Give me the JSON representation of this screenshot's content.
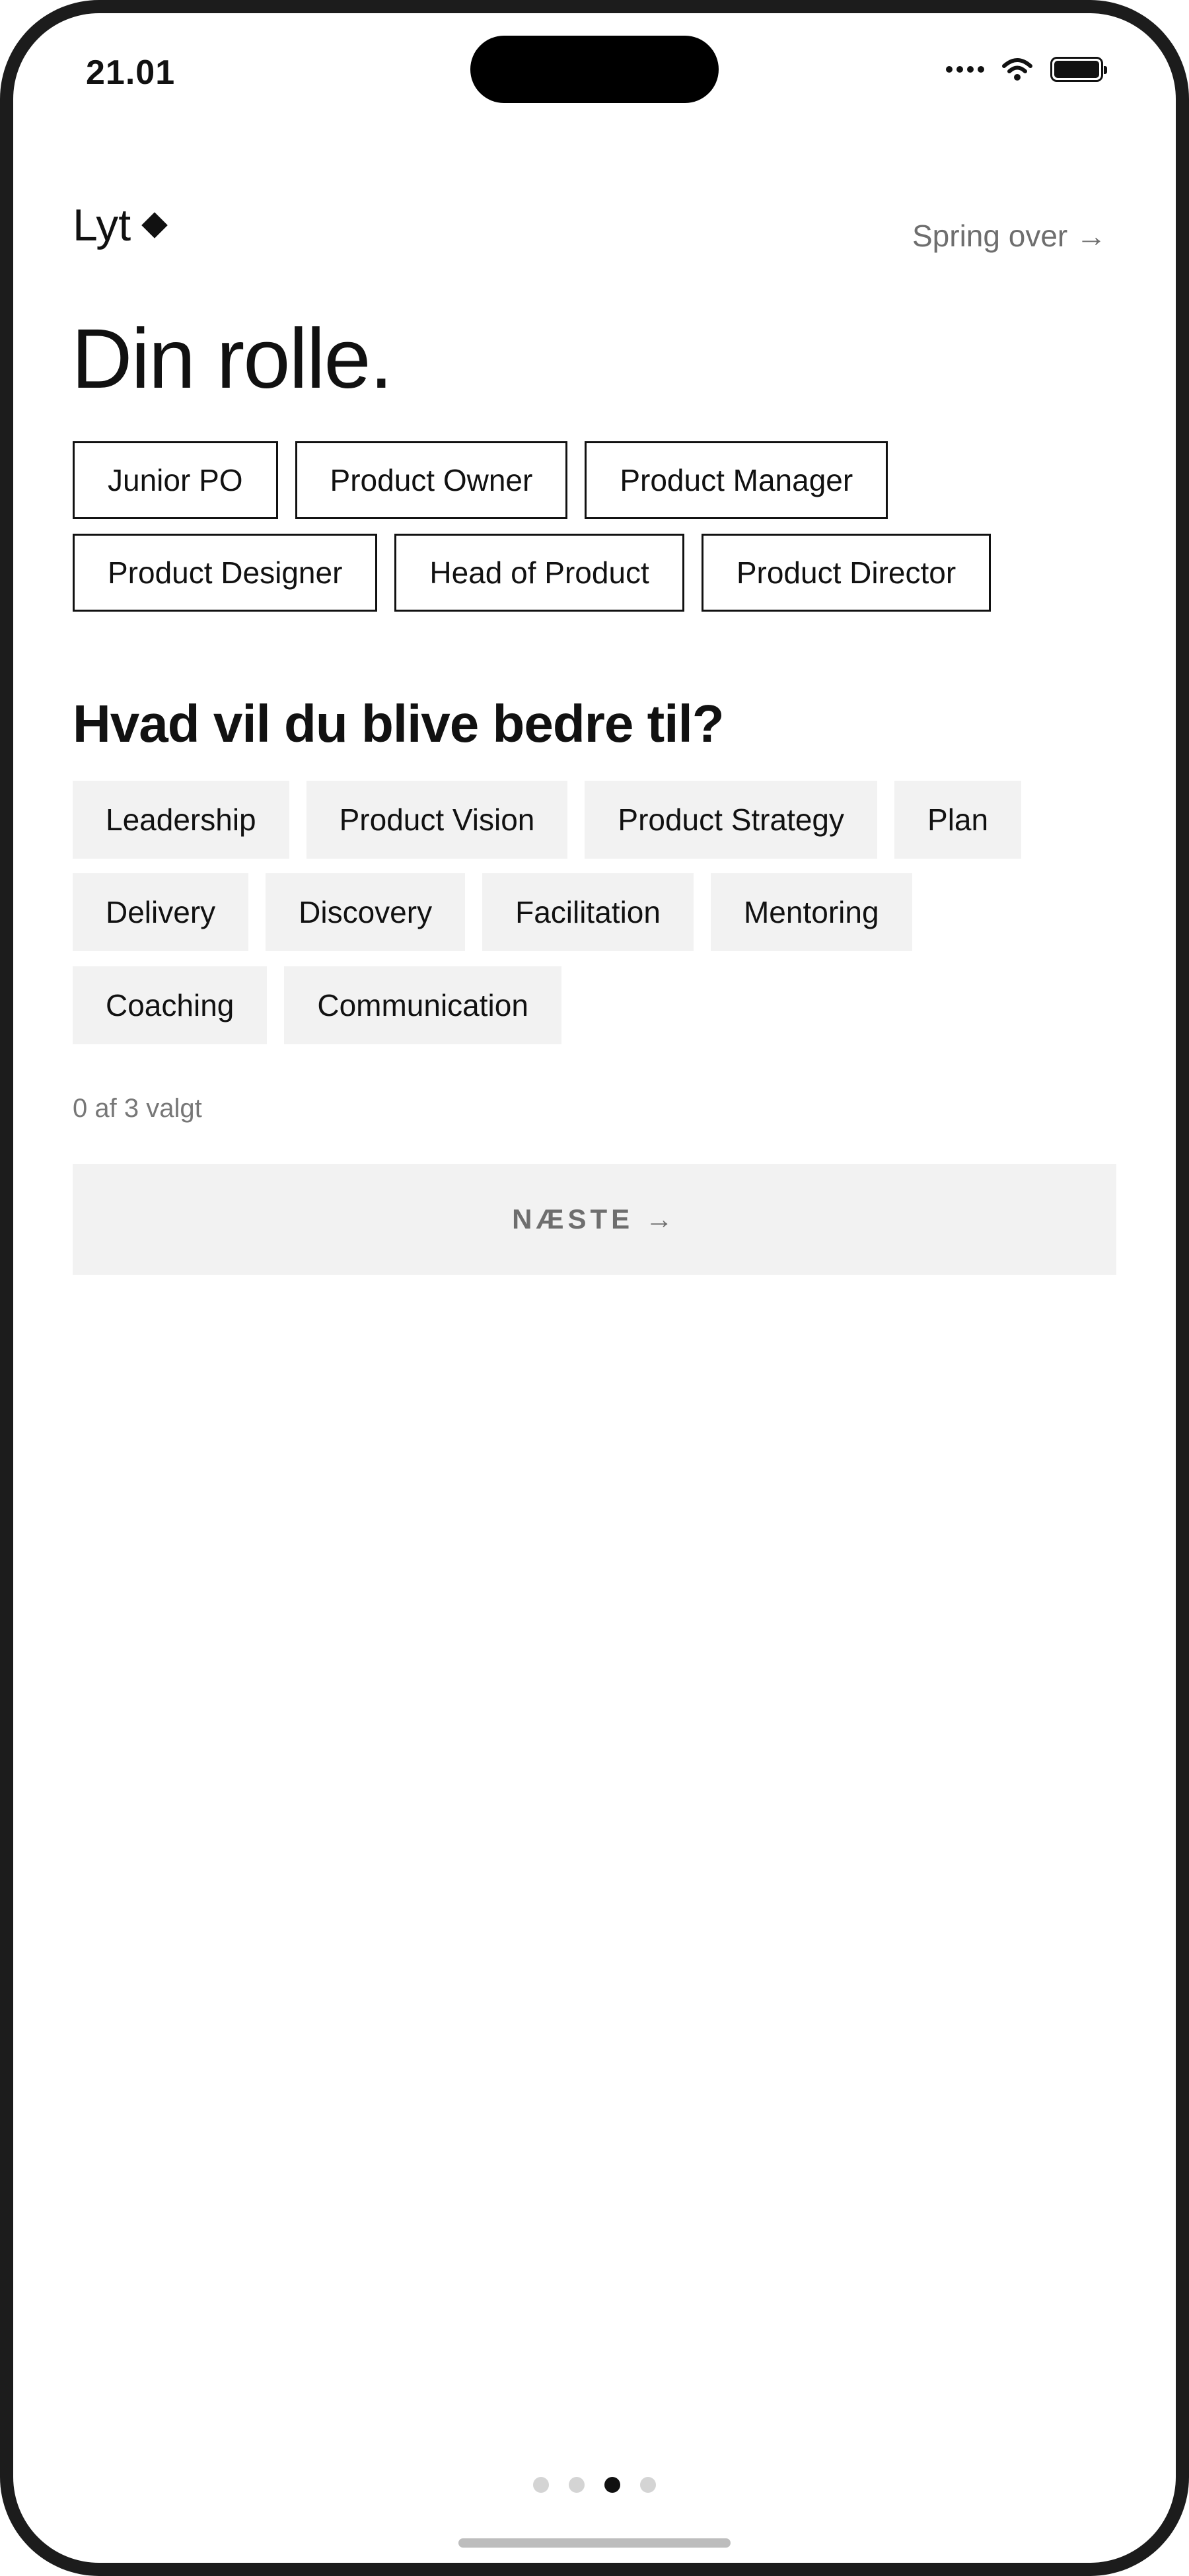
{
  "status_bar": {
    "time": "21.01",
    "icons": [
      "signal-icon",
      "wifi-icon",
      "battery-icon"
    ]
  },
  "header": {
    "brand": "Lyt",
    "brand_icon": "diamond-icon",
    "skip_label": "Spring over →"
  },
  "title": "Din rolle.",
  "roles": [
    [
      "Junior PO",
      "Product Owner",
      "Product Manager"
    ],
    [
      "Product Designer",
      "Head of Product",
      "Product Director"
    ]
  ],
  "skills_title": "Hvad vil du blive bedre til?",
  "skills": [
    [
      "Leadership",
      "Product Vision",
      "Product Strategy",
      "Plan"
    ],
    [
      "Delivery",
      "Discovery",
      "Facilitation",
      "Mentoring"
    ],
    [
      "Coaching",
      "Communication"
    ]
  ],
  "counter": "0 af 3 valgt",
  "next_label": "NÆSTE →",
  "pagination": {
    "total": 4,
    "active": 3
  },
  "colors": {
    "text": "#111111",
    "muted": "#6e6e6e",
    "chip_fill": "#f2f2f2",
    "border": "#111111"
  }
}
